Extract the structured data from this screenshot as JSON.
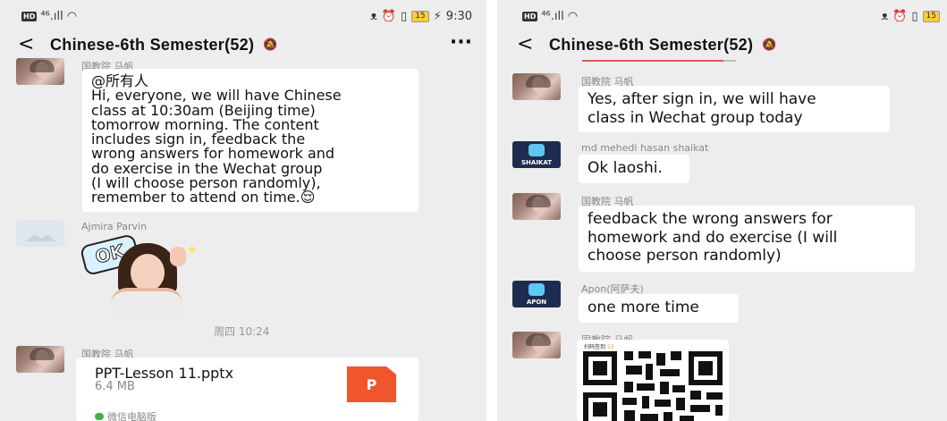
{
  "left": {
    "status": {
      "signal": "⁴⁶.ıll",
      "battery": "15",
      "time": "9:30"
    },
    "header": {
      "title": "Chinese-6th Semester(52)",
      "more": "···"
    },
    "messages": [
      {
        "sender": "国教院 马帆",
        "lines": [
          "@所有人",
          "Hi, everyone, we will have Chinese",
          "class at 10:30am (Beijing time)",
          "tomorrow morning. The content",
          "includes sign in, feedback the",
          "wrong answers for homework and",
          "do exercise in the Wechat group",
          "(I will choose person randomly),",
          "remember to attend on time.😌"
        ]
      },
      {
        "sender": "Ajmira Parvin",
        "sticker_text": "OK"
      },
      {
        "time": "周四 10:24"
      },
      {
        "sender": "国教院 马帆",
        "file": {
          "name": "PPT-Lesson 11.pptx",
          "size": "6.4 MB",
          "icon_letter": "P",
          "source": "微信电脑版"
        }
      }
    ]
  },
  "right": {
    "status": {
      "signal": "⁴⁶.ıll",
      "battery": "15"
    },
    "header": {
      "title": "Chinese-6th Semester(52)"
    },
    "messages": [
      {
        "sender": "国教院 马帆",
        "lines": [
          "Yes, after sign in, we will have",
          "class in Wechat group today"
        ]
      },
      {
        "sender": "md mehedi hasan shaikat",
        "avatar_text": "SHAIKAT",
        "lines": [
          "Ok laoshi."
        ]
      },
      {
        "sender": "国教院 马帆",
        "lines": [
          "feedback the wrong answers for",
          "homework and do exercise (I will",
          "choose person randomly)"
        ]
      },
      {
        "sender": "Apon(阿萨夫)",
        "avatar_text": "APON",
        "lines": [
          "one more time"
        ]
      },
      {
        "sender": "国教院 马帆",
        "qr_caption": "扫码签到",
        "qr_caption_badge": "53"
      }
    ]
  },
  "colors": {
    "background": "#ededed",
    "bubble": "#ffffff",
    "file_icon": "#f0552c",
    "tab_underline": "#e05a50"
  }
}
